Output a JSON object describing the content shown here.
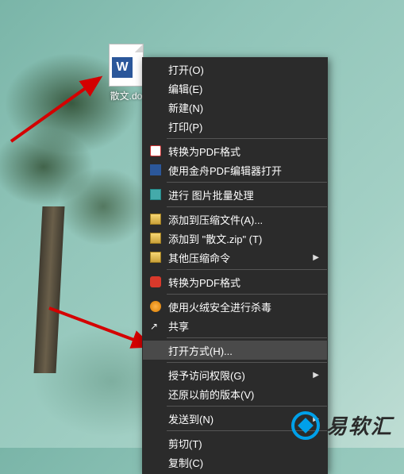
{
  "file": {
    "name": "散文.do",
    "app_letter": "W"
  },
  "menu": {
    "items": [
      {
        "label": "打开(O)",
        "icon": null
      },
      {
        "label": "编辑(E)",
        "icon": null
      },
      {
        "label": "新建(N)",
        "icon": null
      },
      {
        "label": "打印(P)",
        "icon": null
      },
      {
        "sep": true
      },
      {
        "label": "转换为PDF格式",
        "icon": "pdf"
      },
      {
        "label": "使用金舟PDF编辑器打开",
        "icon": "pdfed"
      },
      {
        "sep": true
      },
      {
        "label": "进行 图片批量处理",
        "icon": "img"
      },
      {
        "sep": true
      },
      {
        "label": "添加到压缩文件(A)...",
        "icon": "zip"
      },
      {
        "label": "添加到 \"散文.zip\" (T)",
        "icon": "zip"
      },
      {
        "label": "其他压缩命令",
        "icon": "zip",
        "submenu": true
      },
      {
        "sep": true
      },
      {
        "label": "转换为PDF格式",
        "icon": "red"
      },
      {
        "sep": true
      },
      {
        "label": "使用火绒安全进行杀毒",
        "icon": "shield"
      },
      {
        "label": "共享",
        "icon": "share"
      },
      {
        "sep": true
      },
      {
        "label": "打开方式(H)...",
        "icon": null,
        "highlight": true
      },
      {
        "sep": true
      },
      {
        "label": "授予访问权限(G)",
        "icon": null,
        "submenu": true
      },
      {
        "label": "还原以前的版本(V)",
        "icon": null
      },
      {
        "sep": true
      },
      {
        "label": "发送到(N)",
        "icon": null,
        "submenu": true
      },
      {
        "sep": true
      },
      {
        "label": "剪切(T)",
        "icon": null
      },
      {
        "label": "复制(C)",
        "icon": null
      }
    ]
  },
  "watermark": {
    "text": "易软汇"
  }
}
